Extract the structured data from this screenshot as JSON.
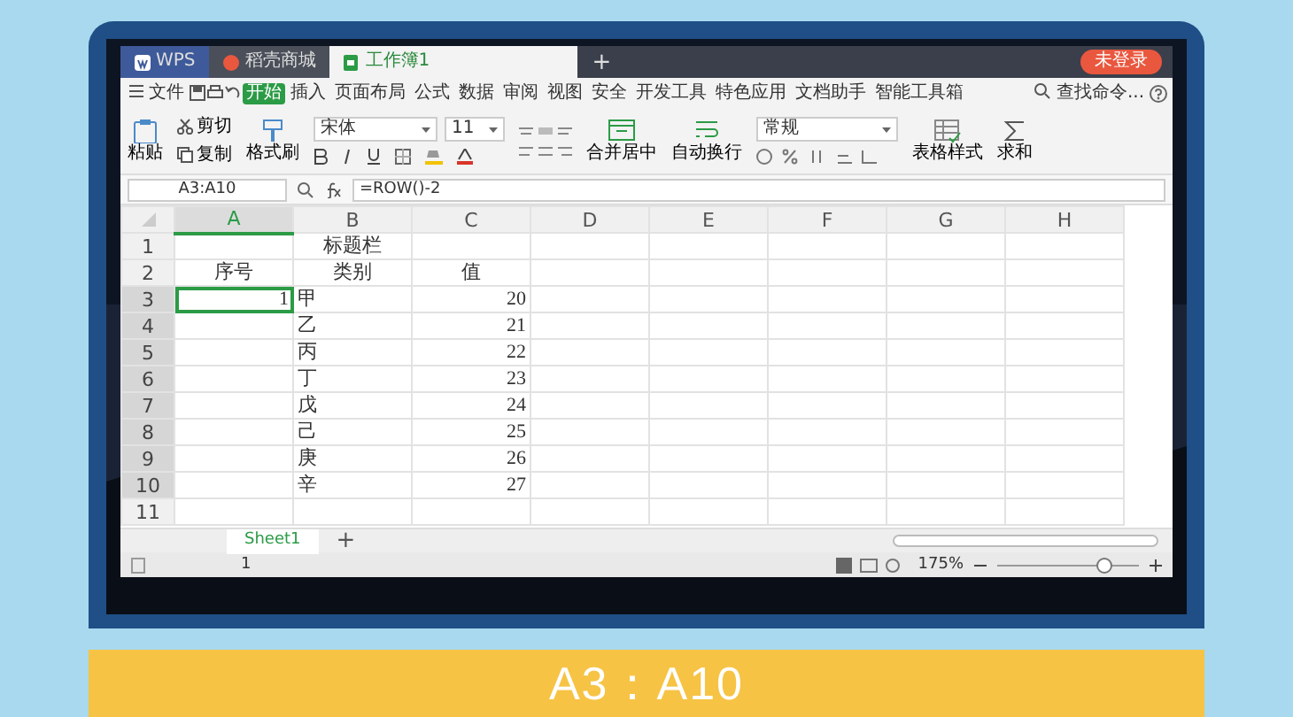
{
  "window": {
    "tabs": [
      {
        "label": "WPS",
        "kind": "wps",
        "selected": false
      },
      {
        "label": "稻壳商城",
        "kind": "store",
        "selected": false
      },
      {
        "label": "工作簿1",
        "kind": "sheet",
        "selected": true
      }
    ],
    "new_tab": "+",
    "account": "未登录"
  },
  "menu": {
    "file": "文件",
    "tabs": [
      {
        "label": "开始",
        "selected": true
      },
      {
        "label": "插入",
        "selected": false
      },
      {
        "label": "页面布局",
        "selected": false
      },
      {
        "label": "公式",
        "selected": false
      },
      {
        "label": "数据",
        "selected": false
      },
      {
        "label": "审阅",
        "selected": false
      },
      {
        "label": "视图",
        "selected": false
      },
      {
        "label": "安全",
        "selected": false
      },
      {
        "label": "开发工具",
        "selected": false
      },
      {
        "label": "特色应用",
        "selected": false
      },
      {
        "label": "文档助手",
        "selected": false
      },
      {
        "label": "智能工具箱",
        "selected": false
      }
    ],
    "search": "查找命令..."
  },
  "ribbon": {
    "paste": "粘贴",
    "cut": "剪切",
    "copy": "复制",
    "format_painter": "格式刷",
    "font": "宋体",
    "font_size": "11",
    "merge": "合并居中",
    "wrap": "自动换行",
    "number_format": "常规",
    "table_style": "表格样式",
    "sum": "求和"
  },
  "formula_bar": {
    "name_box": "A3:A10",
    "formula": "=ROW()-2"
  },
  "sheet": {
    "columns": [
      {
        "label": "A",
        "selected": true
      },
      {
        "label": "B",
        "selected": false
      },
      {
        "label": "C",
        "selected": false
      },
      {
        "label": "D",
        "selected": false
      },
      {
        "label": "E",
        "selected": false
      },
      {
        "label": "F",
        "selected": false
      },
      {
        "label": "G",
        "selected": false
      },
      {
        "label": "H",
        "selected": false
      }
    ],
    "rows": [
      {
        "number": "1",
        "selected": false,
        "cells": [
          {
            "kind": "empty"
          },
          {
            "kind": "header",
            "text": "标题栏"
          },
          {
            "kind": "empty"
          }
        ]
      },
      {
        "number": "2",
        "selected": false,
        "cells": [
          {
            "kind": "header",
            "text": "序号"
          },
          {
            "kind": "header",
            "text": "类别"
          },
          {
            "kind": "header",
            "text": "值"
          }
        ]
      },
      {
        "number": "3",
        "selected": true,
        "cells": [
          {
            "kind": "number",
            "text": "1",
            "active": true
          },
          {
            "kind": "text",
            "text": "甲"
          },
          {
            "kind": "number",
            "text": "20"
          }
        ]
      },
      {
        "number": "4",
        "selected": true,
        "cells": [
          {
            "kind": "empty"
          },
          {
            "kind": "text",
            "text": "乙"
          },
          {
            "kind": "number",
            "text": "21"
          }
        ]
      },
      {
        "number": "5",
        "selected": true,
        "cells": [
          {
            "kind": "empty"
          },
          {
            "kind": "text",
            "text": "丙"
          },
          {
            "kind": "number",
            "text": "22"
          }
        ]
      },
      {
        "number": "6",
        "selected": true,
        "cells": [
          {
            "kind": "empty"
          },
          {
            "kind": "text",
            "text": "丁"
          },
          {
            "kind": "number",
            "text": "23"
          }
        ]
      },
      {
        "number": "7",
        "selected": true,
        "cells": [
          {
            "kind": "empty"
          },
          {
            "kind": "text",
            "text": "戊"
          },
          {
            "kind": "number",
            "text": "24"
          }
        ]
      },
      {
        "number": "8",
        "selected": true,
        "cells": [
          {
            "kind": "empty"
          },
          {
            "kind": "text",
            "text": "己"
          },
          {
            "kind": "number",
            "text": "25"
          }
        ]
      },
      {
        "number": "9",
        "selected": true,
        "cells": [
          {
            "kind": "empty"
          },
          {
            "kind": "text",
            "text": "庚"
          },
          {
            "kind": "number",
            "text": "26"
          }
        ]
      },
      {
        "number": "10",
        "selected": true,
        "cells": [
          {
            "kind": "empty"
          },
          {
            "kind": "text",
            "text": "辛"
          },
          {
            "kind": "number",
            "text": "27"
          }
        ]
      },
      {
        "number": "11",
        "selected": false,
        "cells": []
      }
    ]
  },
  "sheet_tabs": [
    {
      "label": "Sheet1",
      "selected": true
    }
  ],
  "add_sheet": "+",
  "status_bar": {
    "page": "1",
    "zoom": "175%",
    "zoom_slider": {
      "level": 0.75
    }
  },
  "caption": "A3：A10"
}
